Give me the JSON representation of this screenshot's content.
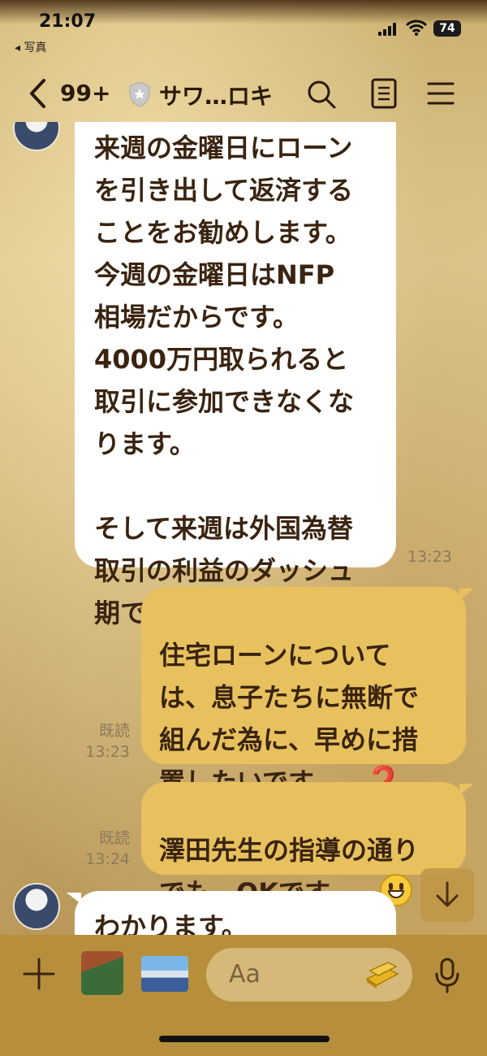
{
  "status_bar": {
    "time": "21:07",
    "back_app": "◂ 写真",
    "battery": "74"
  },
  "header": {
    "unread_count": "99+",
    "title": "サワ…ロキ"
  },
  "messages": [
    {
      "side": "in",
      "text": "来週の金曜日にローン\nを引き出して返済する\nことをお勧めします。\n今週の金曜日はNFP\n相場だからです。\n4000万円取られると\n取引に参加できなくな\nります。\n\nそして来週は外国為替\n取引の利益のダッシュ\n期でもある。",
      "time": "13:23"
    },
    {
      "side": "out",
      "text": "住宅ローンについて\nは、息子たちに無断で\n組んだ為に、早めに措\n置したいです。。。",
      "emoji": "❓",
      "read": "既読",
      "time": "13:23"
    },
    {
      "side": "out",
      "text": "澤田先生の指導の通り\nでも、OKです。。。",
      "emoji": "😃",
      "read": "既読",
      "time": "13:24"
    },
    {
      "side": "in",
      "text": "わかります。"
    }
  ],
  "input": {
    "placeholder": "Aa"
  },
  "icons": [
    "back-chevron-icon",
    "shield-icon",
    "search-icon",
    "notes-icon",
    "menu-icon",
    "plus-icon",
    "gold-bar-sticker-icon",
    "mic-icon",
    "arrow-down-icon"
  ],
  "colors": {
    "incoming_bubble": "#ffffff",
    "outgoing_bubble": "#e8c15f",
    "text": "#3a2410",
    "bottom_bar": "#b78f3c"
  }
}
